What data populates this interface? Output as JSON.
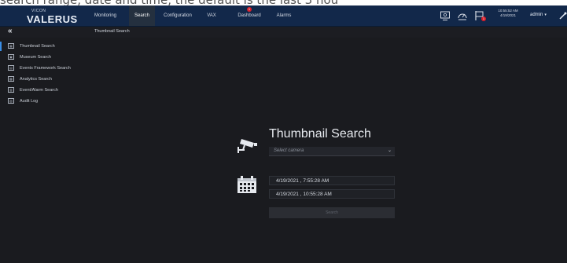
{
  "caption": "search range, date and time, the default is the last 3 hou",
  "app": {
    "logo_small": "VICON",
    "logo_big": "VALERUS"
  },
  "nav": {
    "items": [
      {
        "label": "Monitoring"
      },
      {
        "label": "Search"
      },
      {
        "label": "Configuration"
      },
      {
        "label": "VAX"
      },
      {
        "label": "Dashboard",
        "badge": "1"
      },
      {
        "label": "Alarms"
      }
    ],
    "active": "Search"
  },
  "topbar": {
    "flag_badge": "1",
    "clock_time": "10:55:52 AM",
    "clock_date": "4/19/2021",
    "user": "admin"
  },
  "subbar": {
    "collapse": "«",
    "breadcrumb": "Thumbnail Search"
  },
  "sidebar": {
    "items": [
      {
        "label": "Thumbnail Search",
        "icon": "thumbnail-icon"
      },
      {
        "label": "Museum Search",
        "icon": "museum-icon"
      },
      {
        "label": "Events Framework Search",
        "icon": "events-icon"
      },
      {
        "label": "Analytics Search",
        "icon": "analytics-icon"
      },
      {
        "label": "Event/Alarm Search",
        "icon": "alarm-icon"
      },
      {
        "label": "Audit Log",
        "icon": "audit-icon"
      }
    ],
    "active_index": 0
  },
  "main": {
    "title": "Thumbnail Search",
    "camera_placeholder": "Select camera",
    "start_datetime": "4/19/2021 , 7:55:28 AM",
    "end_datetime": "4/19/2021 , 10:55:28 AM",
    "search_label": "Search"
  },
  "colors": {
    "topbar": "#12284a",
    "background": "#1a1b1f",
    "accent": "#3a8ee6",
    "badge": "#d8202c"
  }
}
